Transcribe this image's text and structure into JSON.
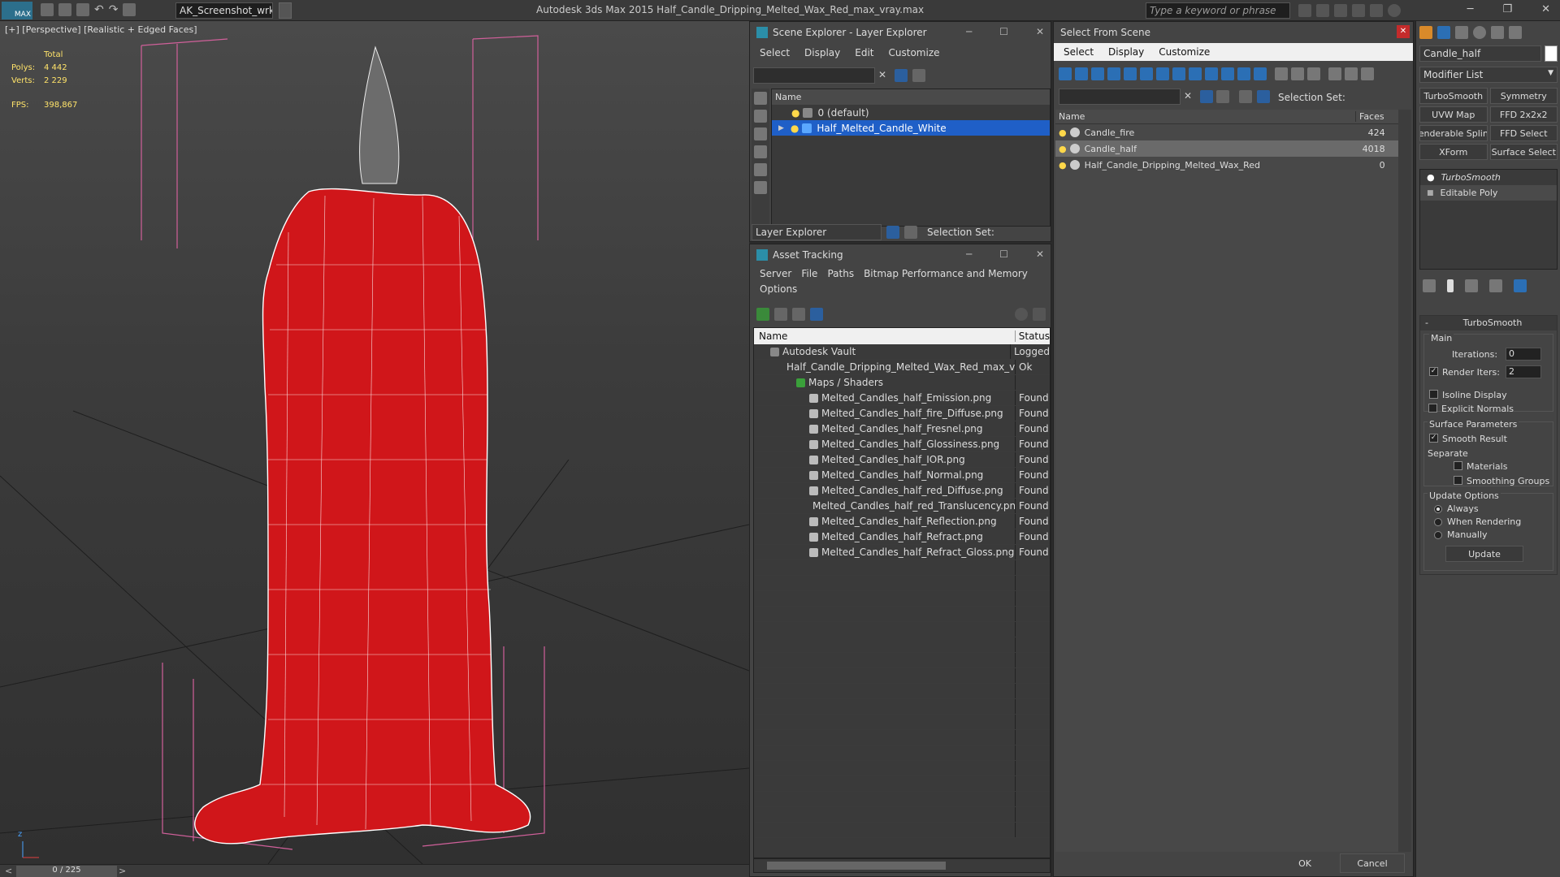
{
  "app": {
    "menu_logo": "MAX",
    "workspace": "AK_Screenshot_wrksp",
    "title": "Autodesk 3ds Max  2015     Half_Candle_Dripping_Melted_Wax_Red_max_vray.max",
    "search_placeholder": "Type a keyword or phrase"
  },
  "viewport": {
    "label": "[+] [Perspective] [Realistic + Edged Faces]",
    "stats_header": "Total",
    "polys_label": "Polys:",
    "polys_value": "4 442",
    "verts_label": "Verts:",
    "verts_value": "2 229",
    "fps_label": "FPS:",
    "fps_value": "398,867",
    "timeline": "0 / 225",
    "axis_z": "z",
    "candle_color": "#d0161a"
  },
  "scene_explorer": {
    "title": "Scene Explorer - Layer Explorer",
    "menus": [
      "Select",
      "Display",
      "Edit",
      "Customize"
    ],
    "col_name": "Name",
    "layers": [
      "0 (default)",
      "Half_Melted_Candle_White"
    ],
    "footer_label": "Layer Explorer",
    "selection_set": "Selection Set:"
  },
  "asset_tracking": {
    "title": "Asset Tracking",
    "menus": [
      "Server",
      "File",
      "Paths",
      "Bitmap Performance and Memory"
    ],
    "menu2": "Options",
    "col_name": "Name",
    "col_status": "Status",
    "rows": [
      {
        "name": "Autodesk Vault",
        "status": "Logged",
        "indent": 0
      },
      {
        "name": "Half_Candle_Dripping_Melted_Wax_Red_max_vr...",
        "status": "Ok",
        "indent": 1
      },
      {
        "name": "Maps / Shaders",
        "status": "",
        "indent": 2
      },
      {
        "name": "Melted_Candles_half_Emission.png",
        "status": "Found",
        "indent": 3
      },
      {
        "name": "Melted_Candles_half_fire_Diffuse.png",
        "status": "Found",
        "indent": 3
      },
      {
        "name": "Melted_Candles_half_Fresnel.png",
        "status": "Found",
        "indent": 3
      },
      {
        "name": "Melted_Candles_half_Glossiness.png",
        "status": "Found",
        "indent": 3
      },
      {
        "name": "Melted_Candles_half_IOR.png",
        "status": "Found",
        "indent": 3
      },
      {
        "name": "Melted_Candles_half_Normal.png",
        "status": "Found",
        "indent": 3
      },
      {
        "name": "Melted_Candles_half_red_Diffuse.png",
        "status": "Found",
        "indent": 3
      },
      {
        "name": "Melted_Candles_half_red_Translucency.png",
        "status": "Found",
        "indent": 3
      },
      {
        "name": "Melted_Candles_half_Reflection.png",
        "status": "Found",
        "indent": 3
      },
      {
        "name": "Melted_Candles_half_Refract.png",
        "status": "Found",
        "indent": 3
      },
      {
        "name": "Melted_Candles_half_Refract_Gloss.png",
        "status": "Found",
        "indent": 3
      }
    ]
  },
  "select_from_scene": {
    "title": "Select From Scene",
    "menus": [
      "Select",
      "Display",
      "Customize"
    ],
    "selection_set": "Selection Set:",
    "col_name": "Name",
    "col_faces": "Faces",
    "rows": [
      {
        "name": "Candle_fire",
        "faces": "424"
      },
      {
        "name": "Candle_half",
        "faces": "4018"
      },
      {
        "name": "Half_Candle_Dripping_Melted_Wax_Red",
        "faces": "0"
      }
    ],
    "ok": "OK",
    "cancel": "Cancel"
  },
  "command_panel": {
    "object_name": "Candle_half",
    "modifier_list": "Modifier List",
    "buttons": [
      "TurboSmooth",
      "Symmetry",
      "UVW Map",
      "FFD 2x2x2",
      "enderable Splin",
      "FFD Select",
      "XForm",
      "Surface Select"
    ],
    "stack": [
      "TurboSmooth",
      "Editable Poly"
    ],
    "rollout_title": "TurboSmooth",
    "main_label": "Main",
    "iterations_label": "Iterations:",
    "iterations_value": "0",
    "render_iters_label": "Render Iters:",
    "render_iters_value": "2",
    "isoline": "Isoline Display",
    "explicit_normals": "Explicit Normals",
    "surface_params": "Surface Parameters",
    "smooth_result": "Smooth Result",
    "separate": "Separate",
    "materials": "Materials",
    "smoothing_groups": "Smoothing Groups",
    "update_options": "Update Options",
    "always": "Always",
    "when_rendering": "When Rendering",
    "manually": "Manually",
    "update_btn": "Update"
  }
}
